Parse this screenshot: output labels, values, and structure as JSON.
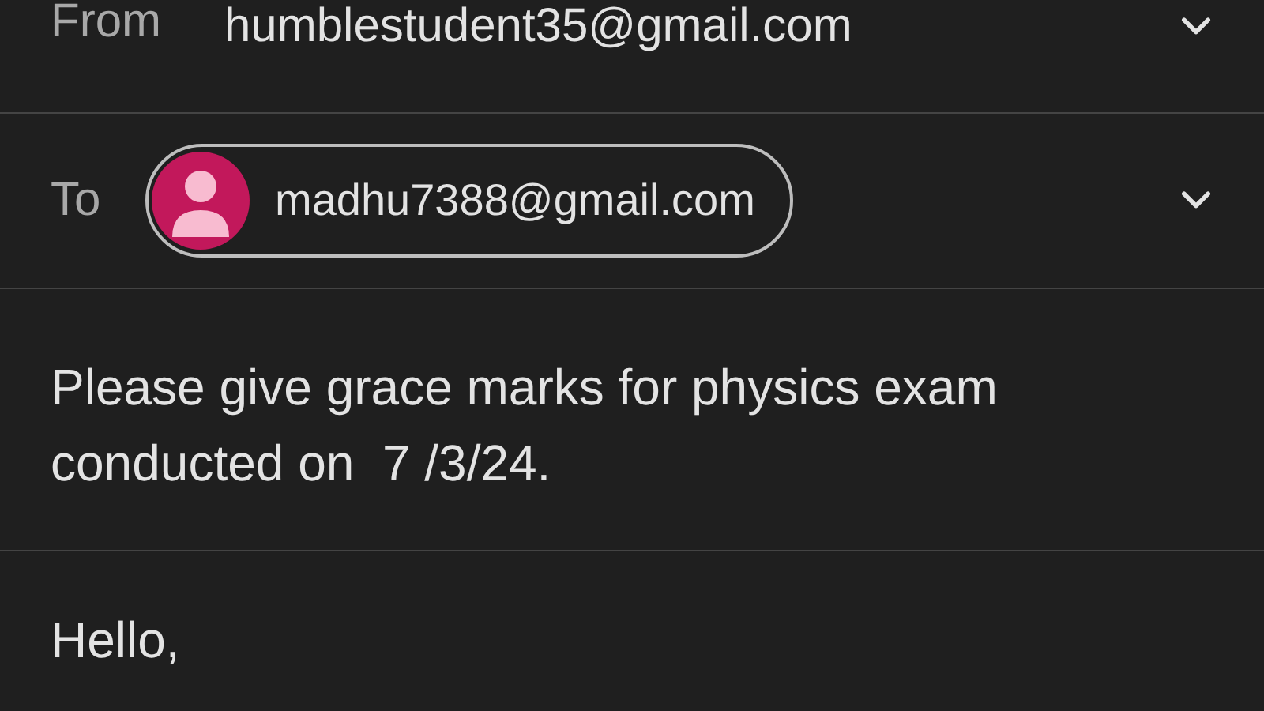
{
  "from": {
    "label": "From",
    "address": "humblestudent35@gmail.com"
  },
  "to": {
    "label": "To",
    "recipients": [
      {
        "address": "madhu7388@gmail.com",
        "color": "#c2185b"
      }
    ]
  },
  "subject": "Please give grace marks for physics exam conducted on  7 /3/24.",
  "body": "Hello,"
}
